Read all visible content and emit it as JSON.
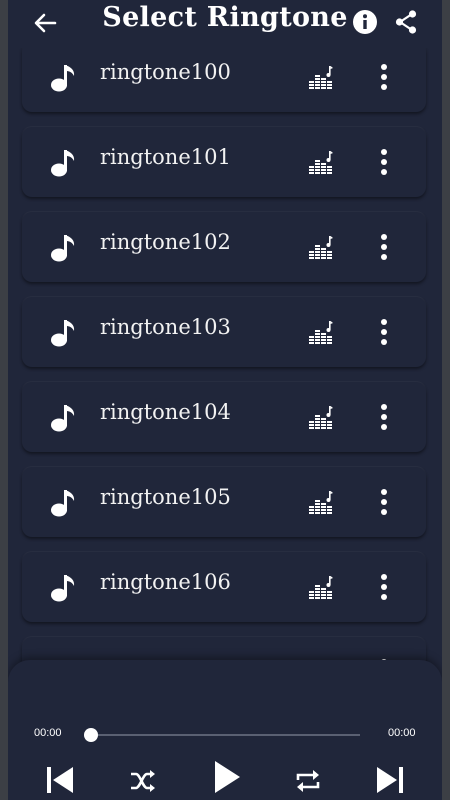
{
  "header": {
    "title": "Select Ringtone",
    "icons": {
      "back": "arrow-left-icon",
      "info": "info-icon",
      "share": "share-icon"
    }
  },
  "ringtones": [
    {
      "name": "ringtone100"
    },
    {
      "name": "ringtone101"
    },
    {
      "name": "ringtone102"
    },
    {
      "name": "ringtone103"
    },
    {
      "name": "ringtone104"
    },
    {
      "name": "ringtone105"
    },
    {
      "name": "ringtone106"
    },
    {
      "name": ""
    }
  ],
  "row_icons": {
    "leading": "music-note-icon",
    "ringtone": "ringtone-equalizer-icon",
    "more": "more-vertical-icon"
  },
  "player": {
    "current_time": "00:00",
    "total_time": "00:00",
    "progress": 0,
    "icons": [
      "skip-previous-icon",
      "shuffle-icon",
      "play-icon",
      "repeat-icon",
      "skip-next-icon"
    ]
  },
  "colors": {
    "background": "#20263a",
    "text": "#ffffff",
    "track": "#5a6072"
  }
}
